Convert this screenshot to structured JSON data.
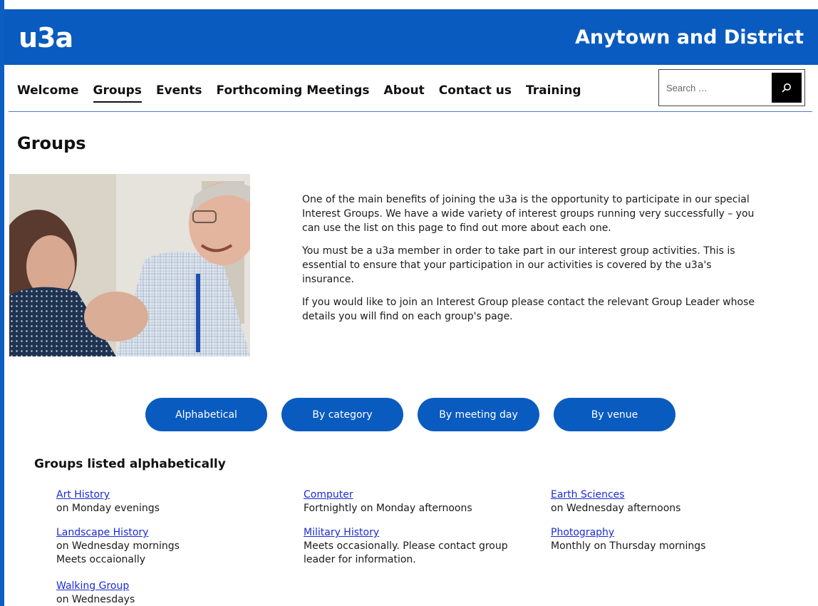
{
  "header": {
    "logo": "u3a",
    "site_name": "Anytown and District",
    "brand_color": "#0a5bbf"
  },
  "nav": {
    "items": [
      {
        "label": "Welcome",
        "active": false
      },
      {
        "label": "Groups",
        "active": true
      },
      {
        "label": "Events",
        "active": false
      },
      {
        "label": "Forthcoming Meetings",
        "active": false
      },
      {
        "label": "About",
        "active": false
      },
      {
        "label": "Contact us",
        "active": false
      },
      {
        "label": "Training",
        "active": false
      }
    ]
  },
  "search": {
    "placeholder": "Search …",
    "value": "",
    "button_icon": "search-icon"
  },
  "page": {
    "title": "Groups",
    "intro": [
      "One of the main benefits of joining the u3a is the opportunity to participate in our special Interest Groups. We have a wide variety of interest groups running very successfully – you can use the list on this page to find out more about each one.",
      "You must be a u3a member in order to take part in our interest group activities. This is essential to ensure that your participation in our activities is covered by the u3a's insurance.",
      "If you would like to join an Interest Group please contact the relevant Group Leader whose details you will find on each group's page."
    ]
  },
  "filters": {
    "buttons": [
      "Alphabetical",
      "By category",
      "By meeting day",
      "By venue"
    ]
  },
  "groups": {
    "heading": "Groups listed alphabetically",
    "items": [
      {
        "name": "Art History",
        "lines": [
          "on Monday evenings"
        ]
      },
      {
        "name": "Computer",
        "lines": [
          "Fortnightly on Monday afternoons"
        ]
      },
      {
        "name": "Earth Sciences",
        "lines": [
          "on Wednesday afternoons"
        ]
      },
      {
        "name": "Landscape History",
        "lines": [
          "on Wednesday mornings",
          "Meets occaionally"
        ]
      },
      {
        "name": "Military History",
        "lines": [
          "Meets occasionally. Please contact group",
          "leader for information."
        ]
      },
      {
        "name": "Photography",
        "lines": [
          "Monthly on Thursday mornings"
        ]
      },
      {
        "name": "Walking Group",
        "lines": [
          "on Wednesdays"
        ]
      }
    ]
  }
}
